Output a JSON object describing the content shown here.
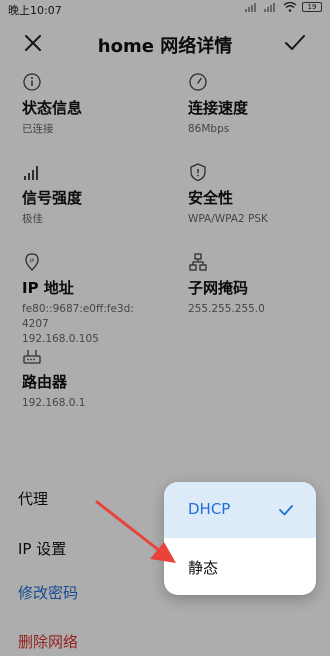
{
  "status_bar": {
    "time": "晚上10:07",
    "battery": "19"
  },
  "header": {
    "title": "home 网络详情"
  },
  "info": [
    {
      "icon": "info-circle-icon",
      "label": "状态信息",
      "value": "已连接"
    },
    {
      "icon": "speedometer-icon",
      "label": "连接速度",
      "value": "86Mbps"
    },
    {
      "icon": "signal-bars-icon",
      "label": "信号强度",
      "value": "极佳"
    },
    {
      "icon": "shield-icon",
      "label": "安全性",
      "value": "WPA/WPA2 PSK"
    },
    {
      "icon": "location-ip-icon",
      "label": "IP 地址",
      "value": "fe80::9687:e0ff:fe3d:\n4207\n192.168.0.105"
    },
    {
      "icon": "network-tree-icon",
      "label": "子网掩码",
      "value": "255.255.255.0"
    },
    {
      "icon": "router-icon",
      "label": "路由器",
      "value": "192.168.0.1"
    }
  ],
  "rows": {
    "proxy": "代理",
    "ip_settings": "IP 设置",
    "change_password": "修改密码",
    "delete_network": "删除网络"
  },
  "popup": {
    "options": [
      "DHCP",
      "静态"
    ],
    "selected": "DHCP"
  },
  "colors": {
    "accent": "#1e6fd9",
    "danger": "#d9312b",
    "arrow": "#e8443b"
  }
}
